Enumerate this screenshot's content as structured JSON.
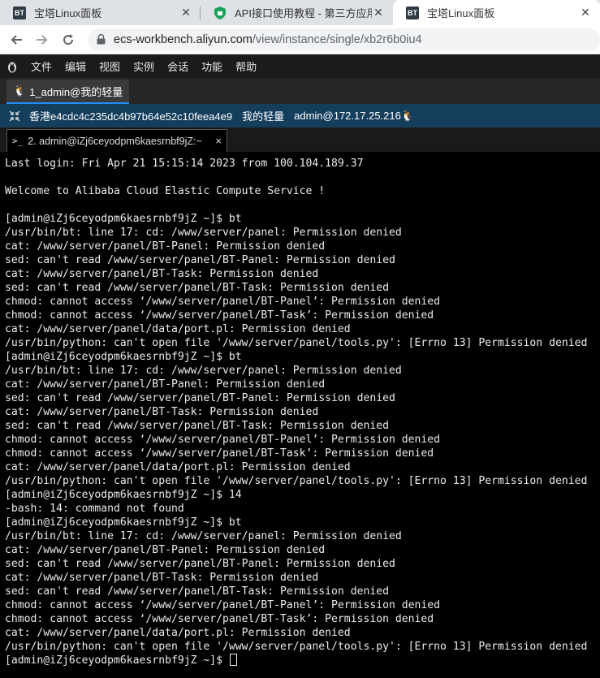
{
  "browser": {
    "tabs": [
      {
        "title": "宝塔Linux面板",
        "favicon": "BT"
      },
      {
        "title": "API接口使用教程 - 第三方应用 -",
        "favicon": "shield-icon"
      },
      {
        "title": "宝塔Linux面板",
        "favicon": "BT"
      }
    ],
    "url_host": "ecs-workbench.aliyun.com",
    "url_path": "/view/instance/single/xb2r6b0iu4"
  },
  "menubar": {
    "items": [
      "文件",
      "编辑",
      "视图",
      "实例",
      "会话",
      "功能",
      "帮助"
    ]
  },
  "session_tab": {
    "label": "1_admin@我的轻量"
  },
  "instance_info": {
    "region_id": "香港e4cdc4c235dc4b97b64e52c10feea4e9",
    "name": "我的轻量",
    "login": "admin@172.17.25.216"
  },
  "terminal_tab": {
    "label": "2. admin@iZj6ceyodpm6kaesrnbf9jZ:~",
    "close": "×"
  },
  "terminal": {
    "lines": [
      "Last login: Fri Apr 21 15:15:14 2023 from 100.104.189.37",
      "",
      "Welcome to Alibaba Cloud Elastic Compute Service !",
      "",
      "[admin@iZj6ceyodpm6kaesrnbf9jZ ~]$ bt",
      "/usr/bin/bt: line 17: cd: /www/server/panel: Permission denied",
      "cat: /www/server/panel/BT-Panel: Permission denied",
      "sed: can't read /www/server/panel/BT-Panel: Permission denied",
      "cat: /www/server/panel/BT-Task: Permission denied",
      "sed: can't read /www/server/panel/BT-Task: Permission denied",
      "chmod: cannot access ‘/www/server/panel/BT-Panel’: Permission denied",
      "chmod: cannot access ‘/www/server/panel/BT-Task’: Permission denied",
      "cat: /www/server/panel/data/port.pl: Permission denied",
      "/usr/bin/python: can't open file '/www/server/panel/tools.py': [Errno 13] Permission denied",
      "[admin@iZj6ceyodpm6kaesrnbf9jZ ~]$ bt",
      "/usr/bin/bt: line 17: cd: /www/server/panel: Permission denied",
      "cat: /www/server/panel/BT-Panel: Permission denied",
      "sed: can't read /www/server/panel/BT-Panel: Permission denied",
      "cat: /www/server/panel/BT-Task: Permission denied",
      "sed: can't read /www/server/panel/BT-Task: Permission denied",
      "chmod: cannot access ‘/www/server/panel/BT-Panel’: Permission denied",
      "chmod: cannot access ‘/www/server/panel/BT-Task’: Permission denied",
      "cat: /www/server/panel/data/port.pl: Permission denied",
      "/usr/bin/python: can't open file '/www/server/panel/tools.py': [Errno 13] Permission denied",
      "[admin@iZj6ceyodpm6kaesrnbf9jZ ~]$ 14",
      "-bash: 14: command not found",
      "[admin@iZj6ceyodpm6kaesrnbf9jZ ~]$ bt",
      "/usr/bin/bt: line 17: cd: /www/server/panel: Permission denied",
      "cat: /www/server/panel/BT-Panel: Permission denied",
      "sed: can't read /www/server/panel/BT-Panel: Permission denied",
      "cat: /www/server/panel/BT-Task: Permission denied",
      "sed: can't read /www/server/panel/BT-Task: Permission denied",
      "chmod: cannot access ‘/www/server/panel/BT-Panel’: Permission denied",
      "chmod: cannot access ‘/www/server/panel/BT-Task’: Permission denied",
      "cat: /www/server/panel/data/port.pl: Permission denied",
      "/usr/bin/python: can't open file '/www/server/panel/tools.py': [Errno 13] Permission denied"
    ],
    "prompt": "[admin@iZj6ceyodpm6kaesrnbf9jZ ~]$ "
  },
  "colors": {
    "terminal_bg": "#000000",
    "terminal_fg": "#ececec",
    "info_bar": "#143e5c",
    "menubar": "#1b1b1b"
  }
}
